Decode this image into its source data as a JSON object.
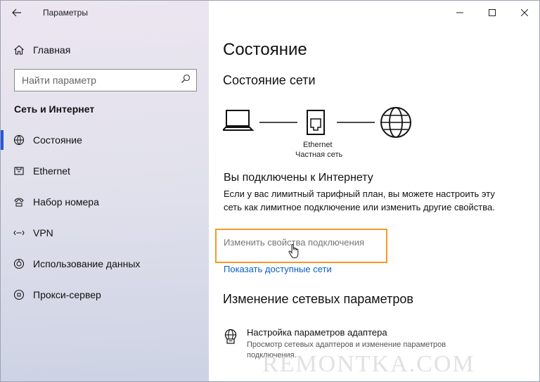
{
  "window": {
    "title": "Параметры",
    "controls": [
      "minimize",
      "maximize",
      "close"
    ]
  },
  "sidebar": {
    "home_label": "Главная",
    "search_placeholder": "Найти параметр",
    "section_title": "Сеть и Интернет",
    "items": [
      {
        "label": "Состояние",
        "icon": "status-icon",
        "active": true
      },
      {
        "label": "Ethernet",
        "icon": "ethernet-icon",
        "active": false
      },
      {
        "label": "Набор номера",
        "icon": "dialup-icon",
        "active": false
      },
      {
        "label": "VPN",
        "icon": "vpn-icon",
        "active": false
      },
      {
        "label": "Использование данных",
        "icon": "data-usage-icon",
        "active": false
      },
      {
        "label": "Прокси-сервер",
        "icon": "proxy-icon",
        "active": false
      }
    ]
  },
  "main": {
    "title": "Состояние",
    "network_status_header": "Состояние сети",
    "diagram": {
      "adapter_name": "Ethernet",
      "network_type": "Частная сеть",
      "icons": [
        "laptop-icon",
        "ethernet-icon",
        "globe-icon"
      ]
    },
    "connected_title": "Вы подключены к Интернету",
    "connected_desc": "Если у вас лимитный тарифный план, вы можете настроить эту сеть как лимитное подключение или изменить другие свойства.",
    "change_props_link": "Изменить свойства подключения",
    "show_networks_link": "Показать доступные сети",
    "change_settings_header": "Изменение сетевых параметров",
    "adapter_settings": {
      "title": "Настройка параметров адаптера",
      "desc": "Просмотр сетевых адаптеров и изменение параметров подключения."
    }
  },
  "watermark": "REMONTKA.COM",
  "colors": {
    "accent": "#2557d6",
    "link": "#0a5fc5",
    "highlight": "#f29a2b"
  }
}
